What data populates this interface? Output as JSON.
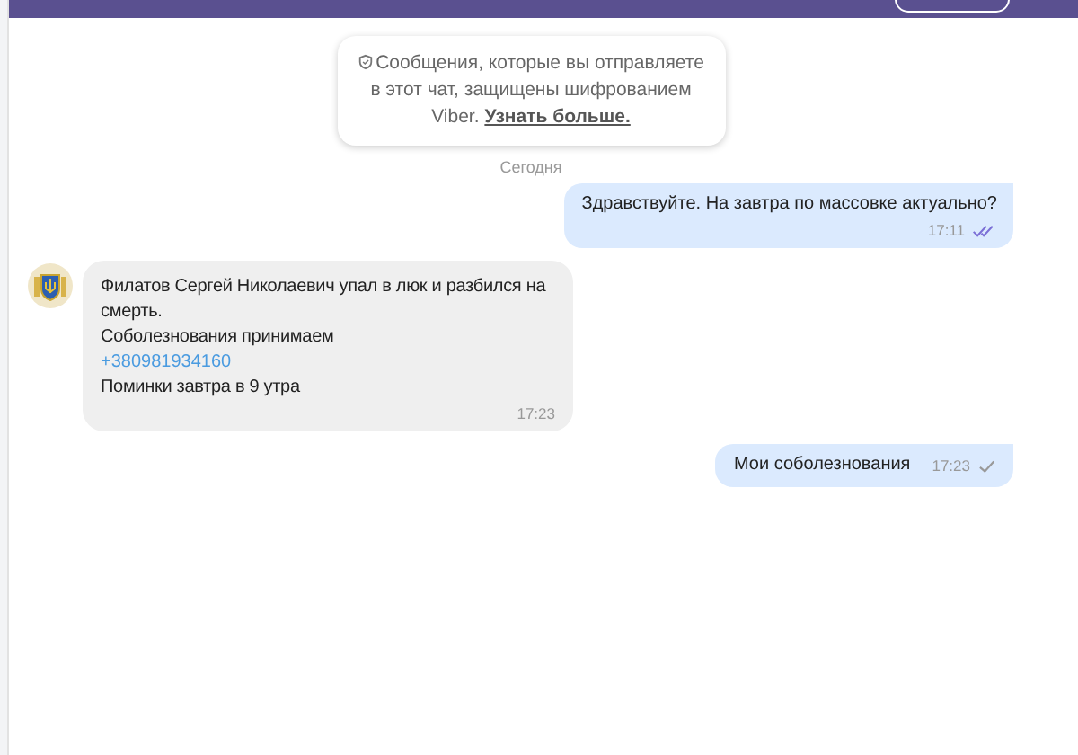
{
  "notice": {
    "text": "Сообщения, которые вы отправляете в этот чат, защищены шифрованием Viber.",
    "link": "Узнать больше."
  },
  "date_divider": "Сегодня",
  "messages": [
    {
      "kind": "outgoing",
      "lines": [
        {
          "kind": "text",
          "text": "Здравствуйте. На завтра по массовке актуально?"
        }
      ],
      "time": "17:11",
      "read": true,
      "inline_time": false
    },
    {
      "kind": "incoming",
      "lines": [
        {
          "kind": "text",
          "text": "Филатов Сергей Николаевич упал в люк и разбился на смерть."
        },
        {
          "kind": "text",
          "text": "Соболезнования принимаем"
        },
        {
          "kind": "link",
          "text": "+380981934160"
        },
        {
          "kind": "text",
          "text": "Поминки завтра в 9 утра"
        }
      ],
      "time": "17:23"
    },
    {
      "kind": "outgoing",
      "lines": [
        {
          "kind": "text",
          "text": "Мои соболезнования"
        }
      ],
      "time": "17:23",
      "read": false,
      "inline_time": true
    }
  ]
}
